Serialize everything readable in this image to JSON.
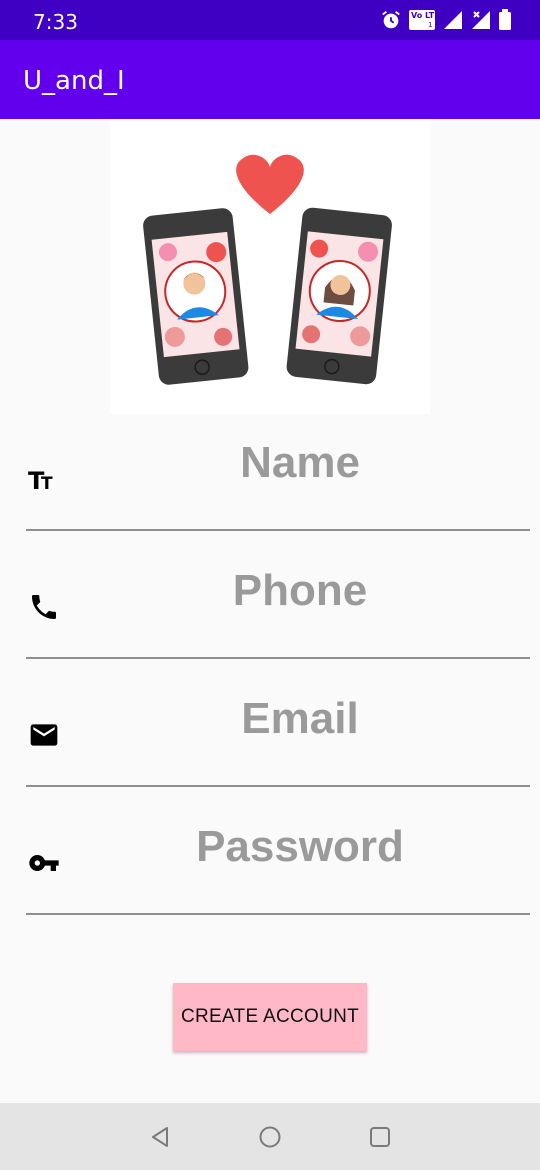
{
  "status_bar": {
    "time": "7:33",
    "icons": [
      "alarm-icon",
      "volte-lte-icon",
      "signal-icon",
      "signal-no-data-icon",
      "battery-icon"
    ],
    "volte_label": "Vo LTE",
    "sim_label": "1 2"
  },
  "app_bar": {
    "title": "U_and_I",
    "color": "#6200ee"
  },
  "hero": {
    "icon": "couple-phones-heart-illustration"
  },
  "form": {
    "name": {
      "placeholder": "Name",
      "icon": "text-size-icon"
    },
    "phone": {
      "placeholder": "Phone",
      "icon": "phone-icon"
    },
    "email": {
      "placeholder": "Email",
      "icon": "mail-icon"
    },
    "password": {
      "placeholder": "Password",
      "icon": "key-icon"
    }
  },
  "actions": {
    "create_account_label": "CREATE ACCOUNT",
    "button_color": "#ffb8c6"
  },
  "nav_bar": {
    "icons": [
      "back-icon",
      "home-icon",
      "recents-icon"
    ]
  }
}
